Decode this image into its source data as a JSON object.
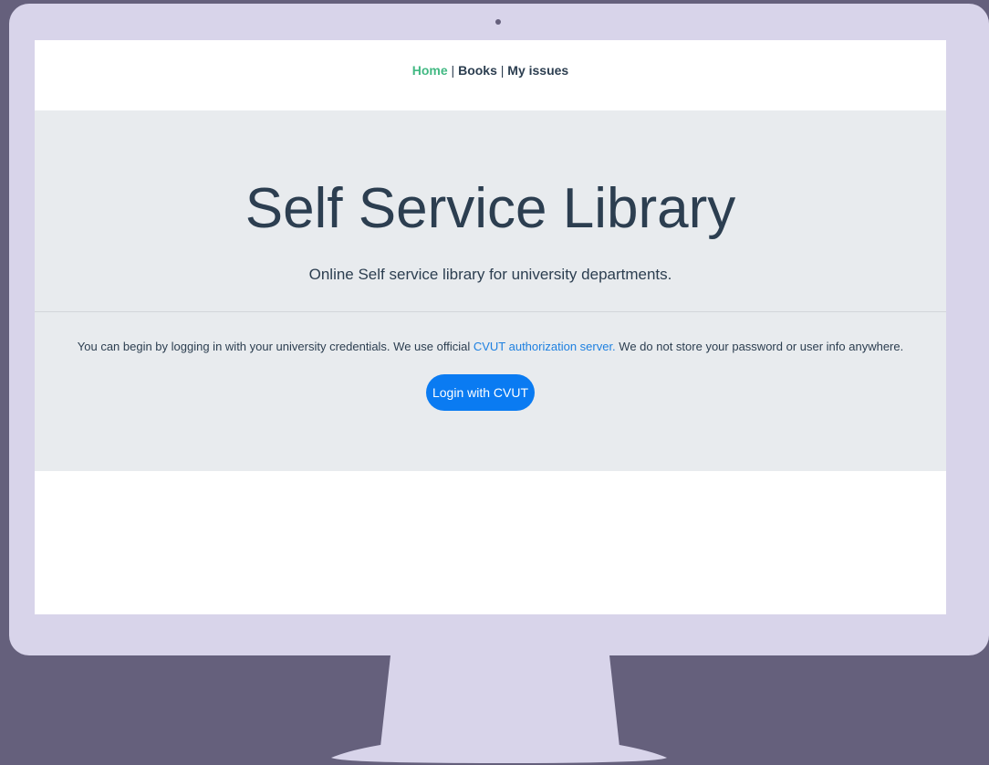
{
  "nav": {
    "home": "Home",
    "separator_1": "|",
    "books": "Books",
    "separator_2": "|",
    "my_issues": "My issues",
    "active_color": "#42b983",
    "text_color": "#2c3e50"
  },
  "hero": {
    "title": "Self Service Library",
    "subtitle": "Online Self service library for university departments."
  },
  "info": {
    "text_before": "You can begin by logging in with your university credentials. We use official ",
    "link": "CVUT authorization server.",
    "text_after": " We do not store your password or user info anywhere."
  },
  "login_button": {
    "label": "Login with CVUT",
    "color": "#0a7bf2"
  },
  "colors": {
    "background": "#65607c",
    "monitor": "#d8d4ea",
    "jumbotron": "#e8ebee",
    "link": "#1e80e0"
  }
}
